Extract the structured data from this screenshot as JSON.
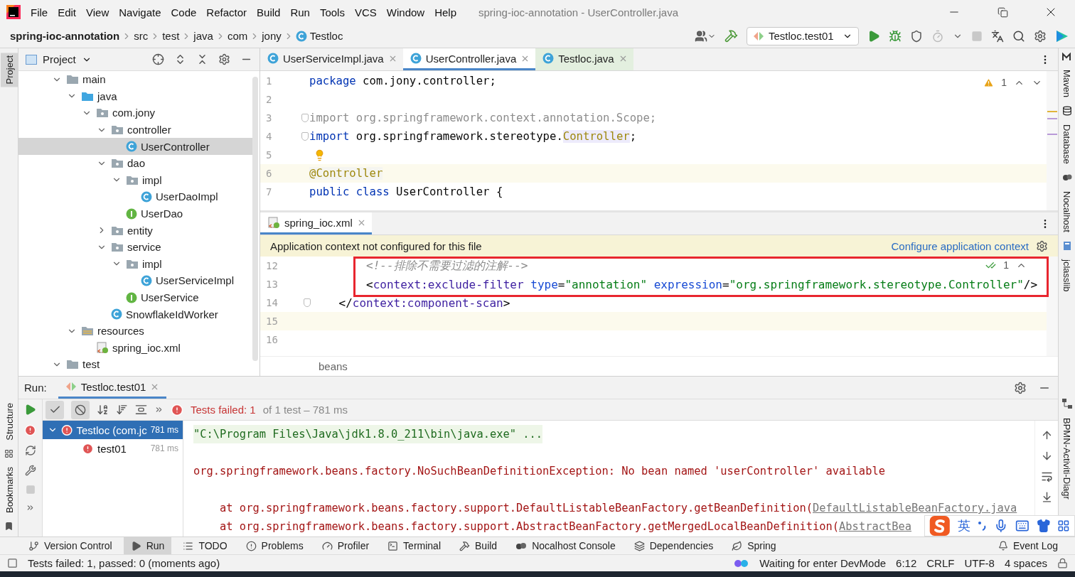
{
  "window": {
    "title": "spring-ioc-annotation - UserController.java"
  },
  "menu": [
    "File",
    "Edit",
    "View",
    "Navigate",
    "Code",
    "Refactor",
    "Build",
    "Run",
    "Tools",
    "VCS",
    "Window",
    "Help"
  ],
  "breadcrumb": [
    {
      "label": "spring-ioc-annotation",
      "kind": "project"
    },
    {
      "label": "src",
      "kind": "folder"
    },
    {
      "label": "test",
      "kind": "folder"
    },
    {
      "label": "java",
      "kind": "folder"
    },
    {
      "label": "com",
      "kind": "folder"
    },
    {
      "label": "jony",
      "kind": "folder"
    },
    {
      "label": "Testloc",
      "kind": "test"
    }
  ],
  "run_config": {
    "label": "Testloc.test01"
  },
  "left_strip": {
    "top": [
      {
        "label": "Project",
        "selected": true
      }
    ],
    "bottom": [
      {
        "label": "Structure",
        "selected": false
      },
      {
        "label": "Bookmarks",
        "selected": false
      }
    ]
  },
  "right_strip": {
    "top": [
      {
        "label": "Maven",
        "kind": "maven"
      },
      {
        "label": "Database",
        "kind": "database"
      },
      {
        "label": "Nocalhost",
        "kind": "nocalhost"
      },
      {
        "label": "jclasslib",
        "kind": "jclasslib"
      }
    ],
    "bottom": [
      {
        "label": "BPMN-Activiti-Diagr",
        "kind": "bpmn"
      }
    ]
  },
  "project": {
    "title": "Project",
    "tree": [
      {
        "label": "main",
        "kind": "folder",
        "selected": false,
        "expanded": true,
        "children": [
          {
            "label": "java",
            "kind": "source",
            "selected": false,
            "expanded": true,
            "children": [
              {
                "label": "com.jony",
                "kind": "package",
                "selected": false,
                "expanded": true,
                "children": [
                  {
                    "label": "controller",
                    "kind": "package",
                    "selected": false,
                    "expanded": true,
                    "children": [
                      {
                        "label": "UserController",
                        "kind": "class",
                        "selected": true
                      }
                    ]
                  },
                  {
                    "label": "dao",
                    "kind": "package",
                    "selected": false,
                    "expanded": true,
                    "children": [
                      {
                        "label": "impl",
                        "kind": "package",
                        "selected": false,
                        "expanded": true,
                        "children": [
                          {
                            "label": "UserDaoImpl",
                            "kind": "class",
                            "selected": false
                          }
                        ]
                      },
                      {
                        "label": "UserDao",
                        "kind": "interface",
                        "selected": false
                      }
                    ]
                  },
                  {
                    "label": "entity",
                    "kind": "package",
                    "selected": false,
                    "expanded": false
                  },
                  {
                    "label": "service",
                    "kind": "package",
                    "selected": false,
                    "expanded": true,
                    "children": [
                      {
                        "label": "impl",
                        "kind": "package",
                        "selected": false,
                        "expanded": true,
                        "children": [
                          {
                            "label": "UserServiceImpl",
                            "kind": "class",
                            "selected": false
                          }
                        ]
                      },
                      {
                        "label": "UserService",
                        "kind": "interface",
                        "selected": false
                      }
                    ]
                  },
                  {
                    "label": "SnowflakeIdWorker",
                    "kind": "class",
                    "selected": false
                  }
                ]
              }
            ]
          },
          {
            "label": "resources",
            "kind": "resources",
            "selected": false,
            "expanded": true,
            "children": [
              {
                "label": "spring_ioc.xml",
                "kind": "xml",
                "selected": false
              }
            ]
          }
        ]
      },
      {
        "label": "test",
        "kind": "folder",
        "selected": false,
        "expanded": true
      }
    ]
  },
  "editor": {
    "tabs": [
      {
        "label": "UserServiceImpl.java",
        "kind": "class",
        "selected": false
      },
      {
        "label": "UserController.java",
        "kind": "class",
        "selected": true
      },
      {
        "label": "Testloc.java",
        "kind": "test",
        "selected": false
      }
    ],
    "warnings": "1",
    "lines": [
      {
        "number": "1",
        "tokens": [
          {
            "kind": "kw",
            "text": "package"
          },
          {
            "kind": "plain",
            "text": " com.jony.controller;"
          }
        ]
      },
      {
        "number": "2"
      },
      {
        "number": "3",
        "fold": true,
        "tokens": [
          {
            "kind": "unused",
            "text": "import org.springframework.context.annotation.Scope;"
          }
        ]
      },
      {
        "number": "4",
        "fold": true,
        "tokens": [
          {
            "kind": "kw",
            "text": "import"
          },
          {
            "kind": "plain",
            "text": " org.springframework.stereotype."
          },
          {
            "kind": "usage",
            "text": "Controller"
          },
          {
            "kind": "plain",
            "text": ";"
          }
        ]
      },
      {
        "number": "5",
        "bulb": true
      },
      {
        "number": "6",
        "highlighted": true,
        "tokens": [
          {
            "kind": "anno",
            "text": "@Controller"
          }
        ]
      },
      {
        "number": "7",
        "tokens": [
          {
            "kind": "kw",
            "text": "public class"
          },
          {
            "kind": "plain",
            "text": " UserController {"
          }
        ]
      }
    ]
  },
  "xml_editor": {
    "tab": {
      "label": "spring_ioc.xml",
      "selected": true
    },
    "banner": {
      "text": "Application context not configured for this file",
      "link": "Configure application context"
    },
    "checks": "1",
    "lines": [
      {
        "number": "12",
        "tokens": [
          {
            "kind": "comment",
            "text": "        <!--排除不需要过滤的注解-->"
          }
        ]
      },
      {
        "number": "13",
        "tokens": [
          {
            "kind": "plain",
            "text": "        <"
          },
          {
            "kind": "tag",
            "text": "context:exclude-filter"
          },
          {
            "kind": "attr",
            "text": " type"
          },
          {
            "kind": "plain",
            "text": "="
          },
          {
            "kind": "string",
            "text": "\"annotation\""
          },
          {
            "kind": "attr",
            "text": " expression"
          },
          {
            "kind": "plain",
            "text": "="
          },
          {
            "kind": "string",
            "text": "\"org.springframework.stereotype.Controller\""
          },
          {
            "kind": "plain",
            "text": "/>"
          }
        ]
      },
      {
        "number": "14",
        "fold": true,
        "tokens": [
          {
            "kind": "plain",
            "text": "    </"
          },
          {
            "kind": "tag",
            "text": "context:component-scan"
          },
          {
            "kind": "plain",
            "text": ">"
          }
        ]
      },
      {
        "number": "15",
        "highlighted": true
      },
      {
        "number": "16"
      }
    ],
    "path": "beans"
  },
  "run": {
    "label": "Run:",
    "tab": {
      "label": "Testloc.test01",
      "selected": true
    },
    "summary": {
      "failed": "Tests failed: 1",
      "rest": "of 1 test – 781 ms"
    },
    "tests": [
      {
        "name": "Testloc (com.jc",
        "time": "781 ms",
        "failed": true,
        "selected": true,
        "expanded": true,
        "children": [
          {
            "name": "test01",
            "time": "781 ms",
            "failed": true,
            "selected": false
          }
        ]
      }
    ],
    "console": [
      {
        "kind": "command",
        "text": "\"C:\\Program Files\\Java\\jdk1.8.0_211\\bin\\java.exe\" ..."
      },
      {
        "kind": "error",
        "text": "org.springframework.beans.factory.NoSuchBeanDefinitionException: No bean named 'userController' available"
      },
      {
        "kind": "stack",
        "text": "    at org.springframework.beans.factory.support.DefaultListableBeanFactory.getBeanDefinition(",
        "link": "DefaultListableBeanFactory.java"
      },
      {
        "kind": "stack",
        "text": "    at org.springframework.beans.factory.support.AbstractBeanFactory.getMergedLocalBeanDefinition(",
        "link": "AbstractBea"
      }
    ]
  },
  "tool_tabs": [
    {
      "label": "Version Control",
      "kind": "vcs",
      "selected": false
    },
    {
      "label": "Run",
      "kind": "run",
      "selected": true
    },
    {
      "label": "TODO",
      "kind": "todo",
      "selected": false
    },
    {
      "label": "Problems",
      "kind": "problems",
      "selected": false
    },
    {
      "label": "Profiler",
      "kind": "profiler",
      "selected": false
    },
    {
      "label": "Terminal",
      "kind": "terminal",
      "selected": false
    },
    {
      "label": "Build",
      "kind": "build",
      "selected": false
    },
    {
      "label": "Nocalhost Console",
      "kind": "nocalhost",
      "selected": false
    },
    {
      "label": "Dependencies",
      "kind": "dependencies",
      "selected": false
    },
    {
      "label": "Spring",
      "kind": "spring",
      "selected": false
    }
  ],
  "event_log": "Event Log",
  "status": {
    "message": "Tests failed: 1, passed: 0 (moments ago)",
    "devmode": "Waiting for enter DevMode",
    "position": "6:12",
    "line_separator": "CRLF",
    "encoding": "UTF-8",
    "indent": "4 spaces"
  },
  "ime": {
    "mode": "英"
  }
}
